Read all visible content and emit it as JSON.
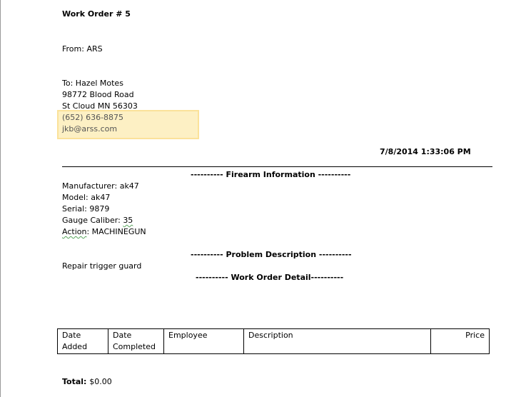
{
  "work_order": {
    "title": "Work Order # 5",
    "from_label": "From:",
    "from_value": "ARS",
    "to_label": "To:",
    "to_name": "Hazel Motes",
    "address_line1": "98772 Blood Road",
    "address_line2": "St Cloud MN 56303",
    "phone": "(652) 636-8875",
    "email": "jkb@arss.com",
    "timestamp": "7/8/2014 1:33:06 PM"
  },
  "firearm": {
    "heading": "---------- Firearm Information ----------",
    "manufacturer": "Manufacturer: ak47",
    "model": "Model: ak47",
    "serial": "Serial: 9879",
    "gauge_label": "Gauge Caliber:",
    "gauge_value": "35",
    "action_label": "Action",
    "action_value": ": MACHINEGUN"
  },
  "problem": {
    "heading": "---------- Problem Description ----------",
    "text": "Repair trigger guard"
  },
  "detail": {
    "heading": "---------- Work Order Detail----------",
    "columns": [
      "Date\nAdded",
      "Date\nCompleted",
      "Employee",
      "Description",
      "Price"
    ]
  },
  "total": {
    "label": "Total:",
    "value": "$0.00"
  }
}
